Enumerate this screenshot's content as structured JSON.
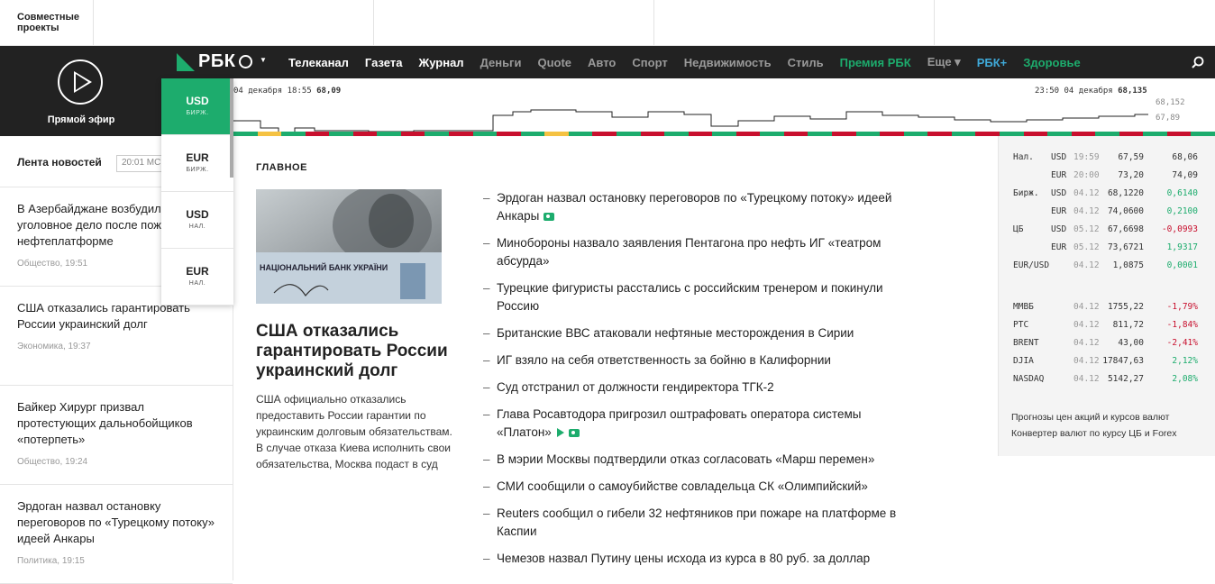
{
  "top": {
    "projects_label": "Совместные проекты"
  },
  "live": {
    "label": "Прямой эфир"
  },
  "nav": {
    "logo": "РБК",
    "items": [
      {
        "label": "Телеканал",
        "color": "#ffffff"
      },
      {
        "label": "Газета",
        "color": "#ffffff"
      },
      {
        "label": "Журнал",
        "color": "#ffffff"
      },
      {
        "label": "Деньги",
        "color": "#9a9a9a"
      },
      {
        "label": "Quote",
        "color": "#9a9a9a"
      },
      {
        "label": "Авто",
        "color": "#9a9a9a"
      },
      {
        "label": "Спорт",
        "color": "#9a9a9a"
      },
      {
        "label": "Недвижимость",
        "color": "#9a9a9a"
      },
      {
        "label": "Стиль",
        "color": "#9a9a9a"
      },
      {
        "label": "Премия РБК",
        "color": "#1dac6d"
      },
      {
        "label": "Еще ▾",
        "color": "#9a9a9a"
      },
      {
        "label": "РБК+",
        "color": "#3fa9d8"
      },
      {
        "label": "Здоровье",
        "color": "#1dac6d"
      }
    ]
  },
  "currency_panel": [
    {
      "code": "USD",
      "sub": "БИРЖ."
    },
    {
      "code": "EUR",
      "sub": "БИРЖ."
    },
    {
      "code": "USD",
      "sub": "НАЛ."
    },
    {
      "code": "EUR",
      "sub": "НАЛ."
    }
  ],
  "ticker": {
    "left_date": "04 декабря 18:55",
    "left_value": "68,09",
    "right_time": "23:50",
    "right_date": "04 декабря",
    "right_value": "68,135",
    "axis_high": "68,152",
    "axis_low": "67,89",
    "bar_segments": [
      "#1dac6d",
      "#f5c242",
      "#1dac6d",
      "#c8102e",
      "#1dac6d",
      "#c8102e",
      "#1dac6d",
      "#c8102e",
      "#1dac6d",
      "#c8102e",
      "#1dac6d",
      "#c8102e",
      "#1dac6d",
      "#f5c242",
      "#1dac6d",
      "#c8102e",
      "#1dac6d",
      "#c8102e",
      "#1dac6d",
      "#c8102e",
      "#1dac6d",
      "#c8102e",
      "#1dac6d",
      "#c8102e",
      "#1dac6d",
      "#c8102e",
      "#1dac6d",
      "#c8102e",
      "#1dac6d",
      "#c8102e",
      "#1dac6d",
      "#c8102e",
      "#1dac6d",
      "#c8102e",
      "#1dac6d",
      "#c8102e",
      "#1dac6d",
      "#c8102e",
      "#1dac6d",
      "#c8102e",
      "#1dac6d"
    ]
  },
  "feed": {
    "title": "Лента новостей",
    "time_placeholder": "20:01 МСК",
    "items": [
      {
        "title": "В Азербайджане возбудили уголовное дело после пожара на нефтеплатформе",
        "meta": "Общество, 19:51"
      },
      {
        "title": "США отказались гарантировать России украинский долг",
        "meta": "Экономика, 19:37"
      },
      {
        "title": "Байкер Хирург призвал протестующих дальнобойщиков «потерпеть»",
        "meta": "Общество, 19:24"
      },
      {
        "title": "Эрдоган назвал остановку переговоров по «Турецкому потоку» идеей Анкары",
        "meta": "Политика, 19:15"
      }
    ]
  },
  "main": {
    "label": "ГЛАВНОЕ",
    "image_caption": "НАЦІОНАЛЬНИЙ БАНК УКРАЇНИ",
    "title": "США отказались гарантировать России украинский долг",
    "lead": "США официально отказались предоставить России гарантии по украинским долговым обязательствам. В случае отказа Киева исполнить свои обязательства, Москва подаст в суд",
    "news": [
      {
        "text": "Эрдоган назвал остановку переговоров по «Турецкому потоку» идеей Анкары",
        "icons": [
          "camera-icon"
        ]
      },
      {
        "text": "Минобороны назвало заявления Пентагона про нефть ИГ «театром абсурда»",
        "icons": []
      },
      {
        "text": "Турецкие фигуристы расстались с российским тренером и покинули Россию",
        "icons": []
      },
      {
        "text": "Британские ВВС атаковали нефтяные месторождения в Сирии",
        "icons": []
      },
      {
        "text": "ИГ взяло на себя ответственность за бойню в Калифорнии",
        "icons": []
      },
      {
        "text": "Суд отстранил от должности гендиректора ТГК-2",
        "icons": []
      },
      {
        "text": "Глава Росавтодора пригрозил оштрафовать оператора системы «Платон»",
        "icons": [
          "video-icon",
          "camera-icon"
        ]
      },
      {
        "text": "В мэрии Москвы подтвердили отказ согласовать «Марш перемен»",
        "icons": []
      },
      {
        "text": "СМИ сообщили о самоубийстве совладельца СК «Олимпийский»",
        "icons": []
      },
      {
        "text": "Reuters сообщил о гибели 32 нефтяников при пожаре на платформе в Каспии",
        "icons": []
      },
      {
        "text": "Чемезов назвал Путину цены исхода из курса в 80 руб. за доллар",
        "icons": []
      }
    ]
  },
  "quotes": {
    "currency_rows": [
      {
        "group": "Нал.",
        "cur": "USD",
        "time": "19:59",
        "v1": "67,59",
        "v2": "68,06",
        "v2_color": "#333333"
      },
      {
        "group": "",
        "cur": "EUR",
        "time": "20:00",
        "v1": "73,20",
        "v2": "74,09",
        "v2_color": "#333333"
      },
      {
        "group": "Бирж.",
        "cur": "USD",
        "time": "04.12",
        "v1": "68,1220",
        "v2": "0,6140",
        "v2_color": "#1dac6d"
      },
      {
        "group": "",
        "cur": "EUR",
        "time": "04.12",
        "v1": "74,0600",
        "v2": "0,2100",
        "v2_color": "#1dac6d"
      },
      {
        "group": "ЦБ",
        "cur": "USD",
        "time": "05.12",
        "v1": "67,6698",
        "v2": "-0,0993",
        "v2_color": "#c8102e"
      },
      {
        "group": "",
        "cur": "EUR",
        "time": "05.12",
        "v1": "73,6721",
        "v2": "1,9317",
        "v2_color": "#1dac6d"
      },
      {
        "group": "EUR/USD",
        "cur": "",
        "time": "04.12",
        "v1": "1,0875",
        "v2": "0,0001",
        "v2_color": "#1dac6d"
      }
    ],
    "index_rows": [
      {
        "name": "ММВБ",
        "time": "04.12",
        "value": "1755,22",
        "change": "-1,79%",
        "color": "#c8102e"
      },
      {
        "name": "РТС",
        "time": "04.12",
        "value": "811,72",
        "change": "-1,84%",
        "color": "#c8102e"
      },
      {
        "name": "BRENT",
        "time": "04.12",
        "value": "43,00",
        "change": "-2,41%",
        "color": "#c8102e"
      },
      {
        "name": "DJIA",
        "time": "04.12",
        "value": "17847,63",
        "change": "2,12%",
        "color": "#1dac6d"
      },
      {
        "name": "NASDAQ",
        "time": "04.12",
        "value": "5142,27",
        "change": "2,08%",
        "color": "#1dac6d"
      }
    ],
    "links": [
      "Прогнозы цен акций и курсов валют",
      "Конвертер валют по курсу ЦБ и Forex"
    ]
  }
}
